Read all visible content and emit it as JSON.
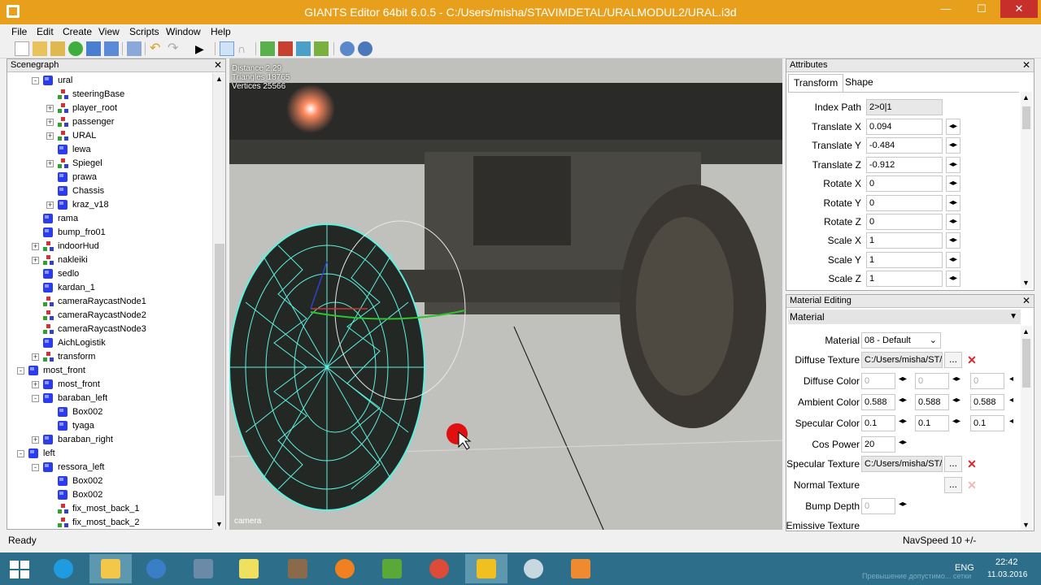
{
  "window": {
    "title": "GIANTS Editor 64bit 6.0.5 - C:/Users/misha/STAVIMDETAL/URALMODUL2/URAL.i3d",
    "minimize": "—",
    "maximize": "☐",
    "close": "✕"
  },
  "menu": [
    "File",
    "Edit",
    "Create",
    "View",
    "Scripts",
    "Window",
    "Help"
  ],
  "scenegraph": {
    "title": "Scenegraph",
    "items": [
      {
        "label": "ural",
        "level": 2,
        "icon": "cube",
        "expander": "-"
      },
      {
        "label": "steeringBase",
        "level": 3,
        "icon": "group",
        "expander": ""
      },
      {
        "label": "player_root",
        "level": 3,
        "icon": "group",
        "expander": "+"
      },
      {
        "label": "passenger",
        "level": 3,
        "icon": "group",
        "expander": "+"
      },
      {
        "label": "URAL",
        "level": 3,
        "icon": "group",
        "expander": "+"
      },
      {
        "label": "lewa",
        "level": 3,
        "icon": "cube",
        "expander": ""
      },
      {
        "label": "Spiegel",
        "level": 3,
        "icon": "group",
        "expander": "+"
      },
      {
        "label": "prawa",
        "level": 3,
        "icon": "cube",
        "expander": ""
      },
      {
        "label": "Chassis",
        "level": 3,
        "icon": "cube",
        "expander": ""
      },
      {
        "label": "kraz_v18",
        "level": 3,
        "icon": "cube",
        "expander": "+"
      },
      {
        "label": "rama",
        "level": 2,
        "icon": "cube",
        "expander": ""
      },
      {
        "label": "bump_fro01",
        "level": 2,
        "icon": "cube",
        "expander": ""
      },
      {
        "label": "indoorHud",
        "level": 2,
        "icon": "group",
        "expander": "+"
      },
      {
        "label": "nakleiki",
        "level": 2,
        "icon": "group",
        "expander": "+"
      },
      {
        "label": "sedlo",
        "level": 2,
        "icon": "cube",
        "expander": ""
      },
      {
        "label": "kardan_1",
        "level": 2,
        "icon": "cube",
        "expander": ""
      },
      {
        "label": "cameraRaycastNode1",
        "level": 2,
        "icon": "group",
        "expander": ""
      },
      {
        "label": "cameraRaycastNode2",
        "level": 2,
        "icon": "group",
        "expander": ""
      },
      {
        "label": "cameraRaycastNode3",
        "level": 2,
        "icon": "group",
        "expander": ""
      },
      {
        "label": "AichLogistik",
        "level": 2,
        "icon": "cube",
        "expander": ""
      },
      {
        "label": "transform",
        "level": 2,
        "icon": "group",
        "expander": "+"
      },
      {
        "label": "most_front",
        "level": 1,
        "icon": "cube",
        "expander": "-"
      },
      {
        "label": "most_front",
        "level": 2,
        "icon": "cube",
        "expander": "+"
      },
      {
        "label": "baraban_left",
        "level": 2,
        "icon": "cube",
        "expander": "-"
      },
      {
        "label": "Box002",
        "level": 3,
        "icon": "cube",
        "expander": ""
      },
      {
        "label": "tyaga",
        "level": 3,
        "icon": "cube",
        "expander": ""
      },
      {
        "label": "baraban_right",
        "level": 2,
        "icon": "cube",
        "expander": "+"
      },
      {
        "label": "left",
        "level": 1,
        "icon": "cube",
        "expander": "-"
      },
      {
        "label": "ressora_left",
        "level": 2,
        "icon": "cube",
        "expander": "-"
      },
      {
        "label": "Box002",
        "level": 3,
        "icon": "cube",
        "expander": ""
      },
      {
        "label": "Box002",
        "level": 3,
        "icon": "cube",
        "expander": ""
      },
      {
        "label": "fix_most_back_1",
        "level": 3,
        "icon": "group",
        "expander": ""
      },
      {
        "label": "fix_most_back_2",
        "level": 3,
        "icon": "group",
        "expander": ""
      }
    ]
  },
  "viewport": {
    "stats": [
      "Distance 2.29",
      "Triangles 18765",
      "Vertices 25566"
    ],
    "camera_label": "camera"
  },
  "attributes": {
    "title": "Attributes",
    "tabs": [
      "Transform",
      "Shape"
    ],
    "index_path_label": "Index Path",
    "index_path": "2>0|1",
    "props": [
      {
        "label": "Translate X",
        "value": "0.094"
      },
      {
        "label": "Translate Y",
        "value": "-0.484"
      },
      {
        "label": "Translate Z",
        "value": "-0.912"
      },
      {
        "label": "Rotate X",
        "value": "0"
      },
      {
        "label": "Rotate Y",
        "value": "0"
      },
      {
        "label": "Rotate Z",
        "value": "0"
      },
      {
        "label": "Scale X",
        "value": "1"
      },
      {
        "label": "Scale Y",
        "value": "1"
      },
      {
        "label": "Scale Z",
        "value": "1"
      }
    ]
  },
  "material_editing": {
    "title": "Material Editing",
    "section": "Material",
    "material_label": "Material",
    "material_value": "08 - Default",
    "diffuse_texture_label": "Diffuse Texture",
    "diffuse_texture": "C:/Users/misha/ST/",
    "diffuse_color_label": "Diffuse Color",
    "diffuse_color": [
      "0",
      "0",
      "0"
    ],
    "ambient_color_label": "Ambient Color",
    "ambient_color": [
      "0.588",
      "0.588",
      "0.588"
    ],
    "specular_color_label": "Specular Color",
    "specular_color": [
      "0.1",
      "0.1",
      "0.1"
    ],
    "cos_power_label": "Cos Power",
    "cos_power": "20",
    "specular_texture_label": "Specular Texture",
    "specular_texture": "C:/Users/misha/ST/",
    "normal_texture_label": "Normal Texture",
    "bump_depth_label": "Bump Depth",
    "bump_depth": "0",
    "emissive_texture_label": "Emissive Texture",
    "browse": "...",
    "delete": "✕"
  },
  "status": {
    "left": "Ready",
    "right": "NavSpeed 10 +/-"
  },
  "taskbar": {
    "lang": "ENG",
    "time": "22:42",
    "date": "11.03.2016",
    "watermark": "Превышение допустимо... сетки"
  },
  "colors": {
    "titlebar": "#e8a01c",
    "taskbar": "#2d6e8a",
    "wireframe": "#5ff0e0"
  }
}
